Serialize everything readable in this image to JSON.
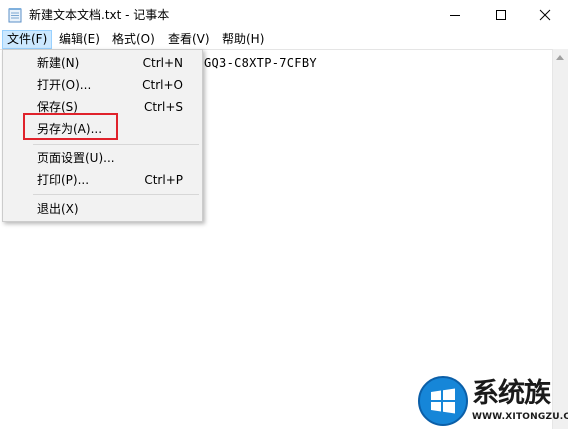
{
  "window": {
    "title": "新建文本文档.txt - 记事本",
    "icons": {
      "app": "notepad-icon",
      "minimize": "minimize-icon",
      "maximize": "maximize-icon",
      "close": "close-icon"
    }
  },
  "menubar": {
    "items": [
      {
        "label": "文件(F)",
        "active": true
      },
      {
        "label": "编辑(E)"
      },
      {
        "label": "格式(O)"
      },
      {
        "label": "查看(V)"
      },
      {
        "label": "帮助(H)"
      }
    ]
  },
  "editor": {
    "visible_text": "GQ3-C8XTP-7CFBY"
  },
  "file_menu": {
    "items": [
      {
        "label": "新建(N)",
        "shortcut": "Ctrl+N"
      },
      {
        "label": "打开(O)...",
        "shortcut": "Ctrl+O"
      },
      {
        "label": "保存(S)",
        "shortcut": "Ctrl+S"
      },
      {
        "label": "另存为(A)...",
        "shortcut": "",
        "highlighted": true
      },
      {
        "label": "页面设置(U)...",
        "shortcut": ""
      },
      {
        "label": "打印(P)...",
        "shortcut": "Ctrl+P"
      },
      {
        "label": "退出(X)",
        "shortcut": ""
      }
    ]
  },
  "watermark": {
    "name": "系统族",
    "url": "WWW.XITONGZU.COM",
    "logo_icon": "windows-logo-icon"
  },
  "colors": {
    "menu_active_bg": "#cce8ff",
    "menu_active_border": "#99d1ff",
    "dropdown_bg": "#f2f2f2",
    "highlight_box": "#e0222b",
    "watermark_blue": "#1686d8"
  }
}
